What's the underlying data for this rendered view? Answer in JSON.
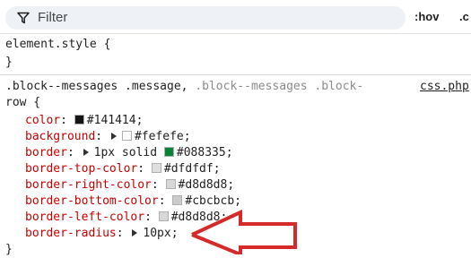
{
  "filter": {
    "placeholder": "Filter",
    "hov_label": ":hov",
    "cls_label": ".c"
  },
  "element_style": {
    "selector": "element.style {",
    "close": "}"
  },
  "rule": {
    "selector_main": ".block--messages .message, ",
    "selector_dim": ".block--messages .block-",
    "selector_cont": "row {",
    "source_link": "css.php",
    "close": "}",
    "declarations": [
      {
        "prop": "color",
        "value": "#141414",
        "swatch": "#141414",
        "triangle": false
      },
      {
        "prop": "background",
        "value": "#fefefe",
        "swatch": "#fefefe",
        "triangle": true
      },
      {
        "prop": "border",
        "value_pre": "1px solid ",
        "value": "#088335",
        "swatch": "#088335",
        "triangle": true
      },
      {
        "prop": "border-top-color",
        "value": "#dfdfdf",
        "swatch": "#dfdfdf",
        "triangle": false
      },
      {
        "prop": "border-right-color",
        "value": "#d8d8d8",
        "swatch": "#d8d8d8",
        "triangle": false
      },
      {
        "prop": "border-bottom-color",
        "value": "#cbcbcb",
        "swatch": "#cbcbcb",
        "triangle": false
      },
      {
        "prop": "border-left-color",
        "value": "#d8d8d8",
        "swatch": "#d8d8d8",
        "triangle": false
      },
      {
        "prop": "border-radius",
        "value": "10px",
        "swatch": null,
        "triangle": true
      }
    ]
  },
  "colors": {
    "property": "#c80000",
    "annotation_arrow": "#d42a2a"
  }
}
